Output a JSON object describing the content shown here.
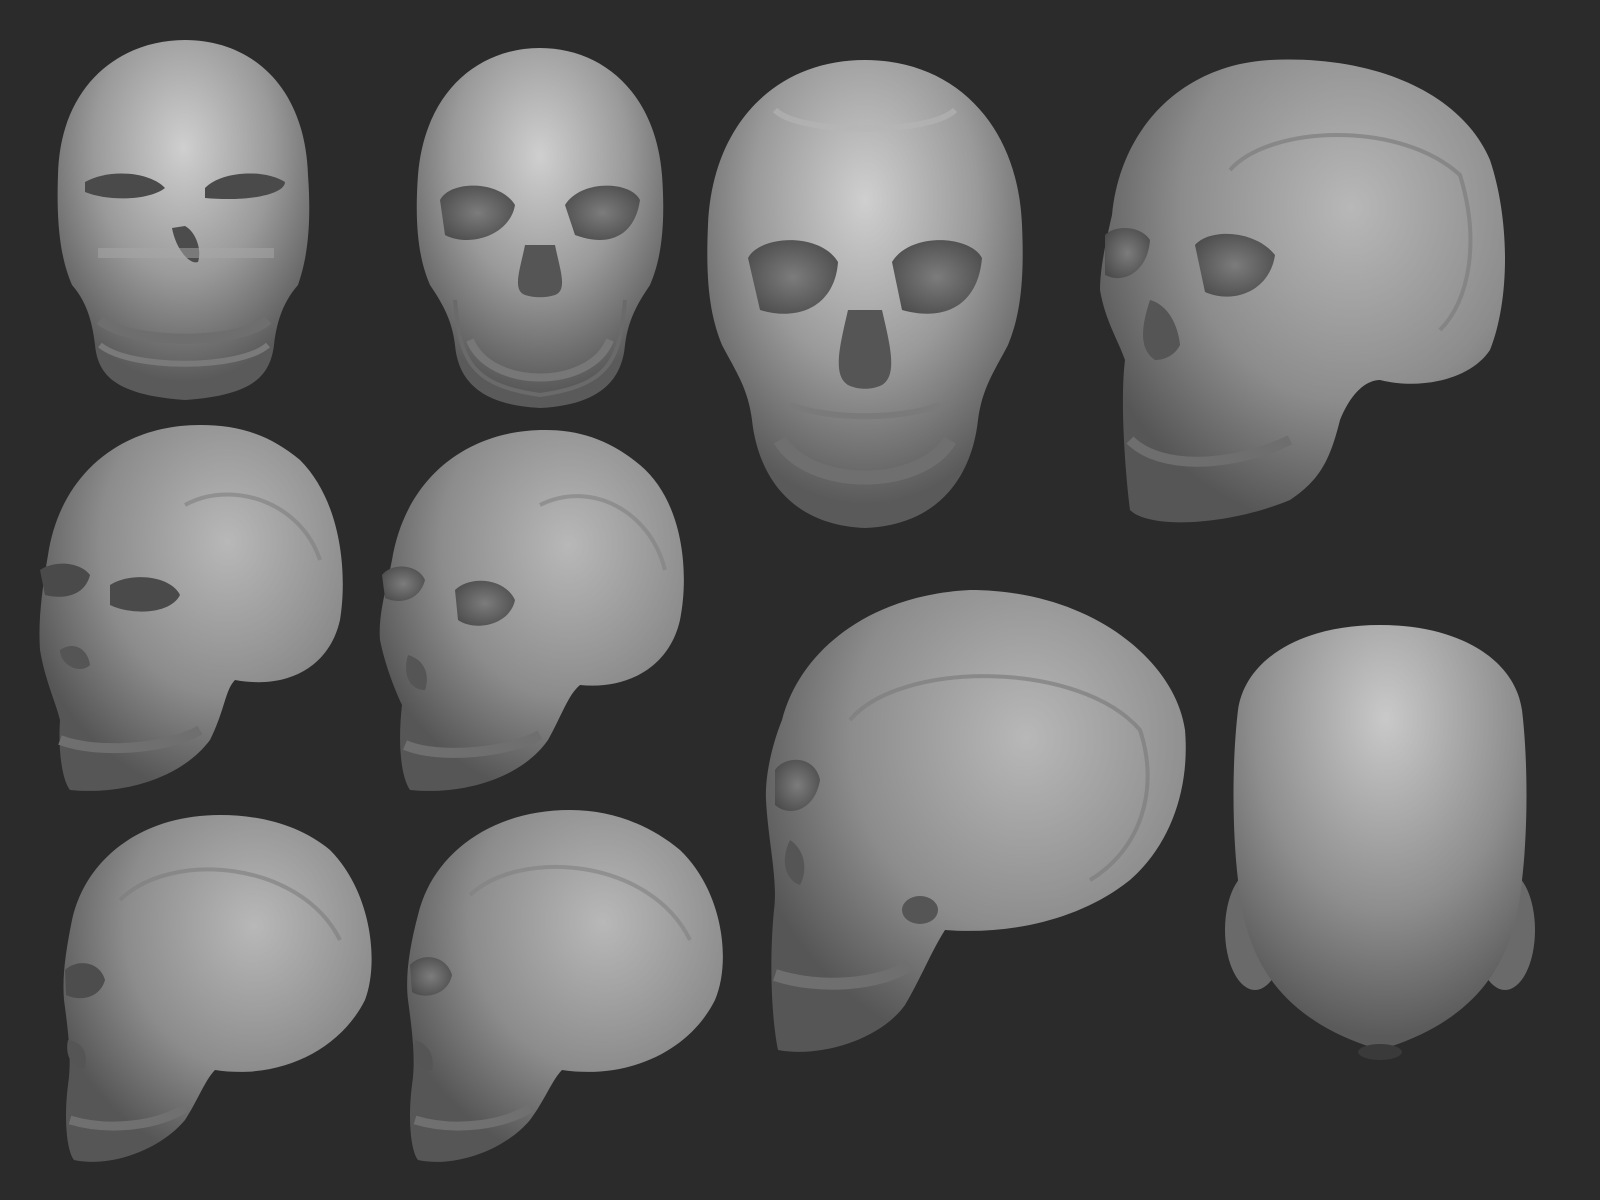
{
  "scene": {
    "background": "#2b2b2b",
    "clay_color": "#9a9a9a",
    "clay_highlight": "#cfcfcf",
    "clay_shadow": "#4f4f4f",
    "models": [
      {
        "id": "skull-front-lowres",
        "view": "front",
        "detail": "low"
      },
      {
        "id": "skull-front-midres",
        "view": "front",
        "detail": "medium"
      },
      {
        "id": "skull-front-highres",
        "view": "front",
        "detail": "high"
      },
      {
        "id": "skull-three-quarter-highres",
        "view": "three-quarter",
        "detail": "high"
      },
      {
        "id": "skull-three-quarter-lowres",
        "view": "three-quarter",
        "detail": "low"
      },
      {
        "id": "skull-three-quarter-midres",
        "view": "three-quarter",
        "detail": "medium"
      },
      {
        "id": "skull-side-highres",
        "view": "side",
        "detail": "high"
      },
      {
        "id": "skull-back-highres",
        "view": "back",
        "detail": "high"
      },
      {
        "id": "skull-side-lowres",
        "view": "side",
        "detail": "low"
      },
      {
        "id": "skull-side-midres",
        "view": "side",
        "detail": "medium"
      }
    ]
  }
}
